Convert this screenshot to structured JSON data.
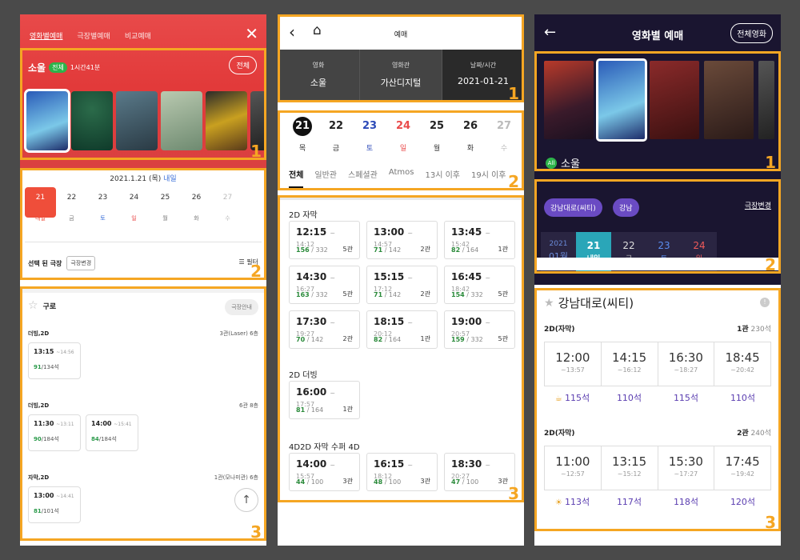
{
  "panel1": {
    "tabs": [
      "영화별예매",
      "극장별예매",
      "비교예매"
    ],
    "close_icon": "close-icon",
    "movie": {
      "name": "소울",
      "rating": "전체",
      "runtime": "1시간41분"
    },
    "all_button": "전체",
    "date_title": "2021.1.21 (목)",
    "date_title_sub": "내일",
    "dates": [
      {
        "n": "21",
        "w": "내일"
      },
      {
        "n": "22",
        "w": "금"
      },
      {
        "n": "23",
        "w": "토"
      },
      {
        "n": "24",
        "w": "일"
      },
      {
        "n": "25",
        "w": "월"
      },
      {
        "n": "26",
        "w": "화"
      },
      {
        "n": "27",
        "w": "수"
      }
    ],
    "selected_theater_label": "선택 된 극장",
    "theater_change": "극장변경",
    "filter": "필터",
    "theater": "구로",
    "theater_guide": "극장안내",
    "groups": [
      {
        "format": "더빙,2D",
        "screen": "3관(Laser) 6층",
        "slots": [
          {
            "time": "13:15",
            "end": "~14:56",
            "avail": "91",
            "total": "/134석"
          }
        ]
      },
      {
        "format": "더빙,2D",
        "screen": "6관 8층",
        "slots": [
          {
            "time": "11:30",
            "end": "~13:11",
            "avail": "90",
            "total": "/184석"
          },
          {
            "time": "14:00",
            "end": "~15:41",
            "avail": "84",
            "total": "/184석"
          }
        ]
      },
      {
        "format": "자막,2D",
        "screen": "1관(모나미관) 6층",
        "slots": [
          {
            "time": "13:00",
            "end": "~14:41",
            "avail": "81",
            "total": "/101석"
          }
        ]
      }
    ],
    "badge_1": "1",
    "badge_2": "2",
    "badge_3": "3"
  },
  "panel2": {
    "title": "예매",
    "info": [
      {
        "k": "영화",
        "v": "소울"
      },
      {
        "k": "영화관",
        "v": "가산디지털"
      },
      {
        "k": "날짜/시간",
        "v": "2021-01-21"
      }
    ],
    "dates": [
      {
        "n": "21",
        "w": "목"
      },
      {
        "n": "22",
        "w": "금"
      },
      {
        "n": "23",
        "w": "토"
      },
      {
        "n": "24",
        "w": "일"
      },
      {
        "n": "25",
        "w": "월"
      },
      {
        "n": "26",
        "w": "화"
      },
      {
        "n": "27",
        "w": "수"
      }
    ],
    "filters": [
      "전체",
      "일반관",
      "스페셜관",
      "Atmos",
      "13시 이후",
      "19시 이후"
    ],
    "sections": [
      {
        "title": "2D  자막",
        "slots": [
          {
            "t": "12:15",
            "e": "~ 14:12",
            "a": "156",
            "s": "/ 332",
            "h": "5관"
          },
          {
            "t": "13:00",
            "e": "~ 14:57",
            "a": "71",
            "s": "/ 142",
            "h": "2관"
          },
          {
            "t": "13:45",
            "e": "~ 15:42",
            "a": "82",
            "s": "/ 164",
            "h": "1관"
          },
          {
            "t": "14:30",
            "e": "~ 16:27",
            "a": "163",
            "s": "/ 332",
            "h": "5관"
          },
          {
            "t": "15:15",
            "e": "~ 17:12",
            "a": "71",
            "s": "/ 142",
            "h": "2관"
          },
          {
            "t": "16:45",
            "e": "~ 18:42",
            "a": "154",
            "s": "/ 332",
            "h": "5관"
          },
          {
            "t": "17:30",
            "e": "~ 19:27",
            "a": "70",
            "s": "/ 142",
            "h": "2관"
          },
          {
            "t": "18:15",
            "e": "~ 20:12",
            "a": "82",
            "s": "/ 164",
            "h": "1관"
          },
          {
            "t": "19:00",
            "e": "~ 20:57",
            "a": "159",
            "s": "/ 332",
            "h": "5관"
          }
        ]
      },
      {
        "title": "2D  더빙",
        "slots": [
          {
            "t": "16:00",
            "e": "~ 17:57",
            "a": "81",
            "s": "/ 164",
            "h": "1관"
          }
        ]
      },
      {
        "title": "4D2D  자막  수퍼 4D",
        "slots": [
          {
            "t": "14:00",
            "e": "~ 15:57",
            "a": "44",
            "s": "/ 100",
            "h": "3관"
          },
          {
            "t": "16:15",
            "e": "~ 18:12",
            "a": "48",
            "s": "/ 100",
            "h": "3관"
          },
          {
            "t": "18:30",
            "e": "~ 20:27",
            "a": "47",
            "s": "/ 100",
            "h": "3관"
          }
        ]
      }
    ],
    "badge_1": "1",
    "badge_2": "2",
    "badge_3": "3"
  },
  "panel3": {
    "title": "영화별 예매",
    "all_button": "전체영화",
    "movie": {
      "rating": "All",
      "name": "소울"
    },
    "chips": [
      "강남대로(씨티)",
      "강남"
    ],
    "theater_change": "극장변경",
    "dates": [
      {
        "n": "2021",
        "w": "01월"
      },
      {
        "n": "21",
        "w": "내일"
      },
      {
        "n": "22",
        "w": "금"
      },
      {
        "n": "23",
        "w": "토"
      },
      {
        "n": "24",
        "w": "일"
      }
    ],
    "theater": "강남대로(씨티)",
    "groups": [
      {
        "format": "2D(자막)",
        "hall": "1관",
        "seats": "230석",
        "slots": [
          {
            "t": "12:00",
            "e": "~13:57",
            "s": "115석"
          },
          {
            "t": "14:15",
            "e": "~16:12",
            "s": "110석"
          },
          {
            "t": "16:30",
            "e": "~18:27",
            "s": "115석"
          },
          {
            "t": "18:45",
            "e": "~20:42",
            "s": "110석"
          }
        ]
      },
      {
        "format": "2D(자막)",
        "hall": "2관",
        "seats": "240석",
        "slots": [
          {
            "t": "11:00",
            "e": "~12:57",
            "s": "113석"
          },
          {
            "t": "13:15",
            "e": "~15:12",
            "s": "117석"
          },
          {
            "t": "15:30",
            "e": "~17:27",
            "s": "118석"
          },
          {
            "t": "17:45",
            "e": "~19:42",
            "s": "120석"
          }
        ]
      }
    ],
    "badge_1": "1",
    "badge_2": "2",
    "badge_3": "3"
  }
}
